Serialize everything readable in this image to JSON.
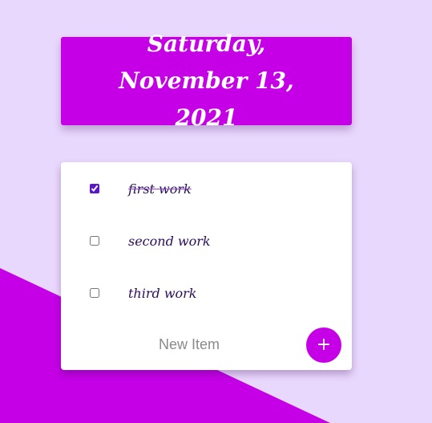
{
  "colors": {
    "background": "#e9d8fd",
    "accent": "#c500e6",
    "text": "#2c0d5a",
    "checkbox": "#5b18c9"
  },
  "heading": {
    "date": "Saturday, November 13, 2021"
  },
  "todo": {
    "items": [
      {
        "label": "first work",
        "checked": true
      },
      {
        "label": "second work",
        "checked": false
      },
      {
        "label": "third work",
        "checked": false
      }
    ],
    "new_item_placeholder": "New Item",
    "add_button_label": "+",
    "add_button_icon": "plus-icon"
  }
}
